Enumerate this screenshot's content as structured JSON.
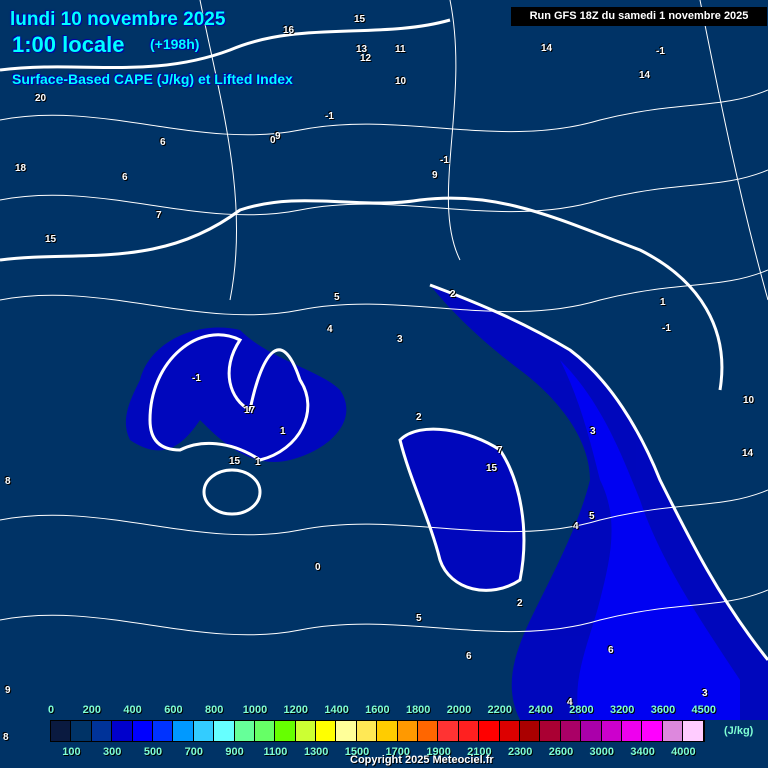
{
  "header": {
    "date": "lundi 10 novembre 2025",
    "time": "1:00 locale",
    "lead": "(+198h)",
    "parameter": "Surface-Based CAPE (J/kg) et Lifted Index",
    "run": "Run GFS 18Z du samedi 1 novembre 2025"
  },
  "map_labels": [
    "20",
    "16",
    "15",
    "14",
    "13",
    "12",
    "11",
    "10",
    "9",
    "15",
    "14",
    "6",
    "18",
    "6",
    "7",
    "8",
    "9",
    "5",
    "4",
    "3",
    "2",
    "1",
    "0",
    "-1",
    "1",
    "2",
    "3",
    "4",
    "5",
    "6",
    "15",
    "17",
    "7",
    "15",
    "-1",
    "-1",
    "-1",
    "0",
    "-1",
    "1",
    "2",
    "3",
    "4",
    "5",
    "6",
    "10",
    "9",
    "8",
    "14"
  ],
  "colorbar": {
    "unit": "(J/kg)",
    "colors": [
      "#0a1a40",
      "#003366",
      "#003399",
      "#0000cc",
      "#0000ff",
      "#0033ff",
      "#0099ff",
      "#33ccff",
      "#66ffff",
      "#66ff99",
      "#66ff66",
      "#66ff00",
      "#ccff33",
      "#ffff00",
      "#ffff99",
      "#ffe855",
      "#ffcc00",
      "#ff9900",
      "#ff6600",
      "#ff3333",
      "#ff2020",
      "#ff0000",
      "#dd0000",
      "#aa0000",
      "#aa0033",
      "#aa0066",
      "#aa00aa",
      "#cc00cc",
      "#ee00ee",
      "#ff00ff",
      "#dd88dd",
      "#ffccff",
      "#ffffff"
    ],
    "top_ticks": [
      "0",
      "200",
      "400",
      "600",
      "800",
      "1000",
      "1200",
      "1400",
      "1600",
      "1800",
      "2000",
      "2200",
      "2400",
      "2800",
      "3200",
      "3600",
      "4500"
    ],
    "bottom_ticks": [
      "100",
      "300",
      "500",
      "700",
      "900",
      "1100",
      "1300",
      "1500",
      "1700",
      "1900",
      "2100",
      "2300",
      "2600",
      "3000",
      "3400",
      "4000"
    ]
  },
  "footer": {
    "copyright": "Copyright 2025 Meteociel.fr"
  }
}
